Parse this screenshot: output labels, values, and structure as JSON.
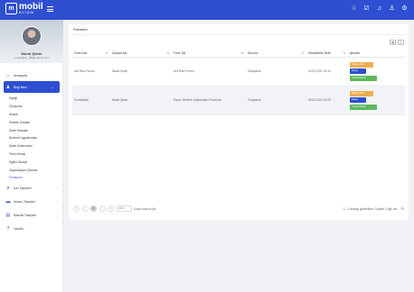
{
  "brand": {
    "logo_main": "mobil",
    "logo_sub": "BİLİŞİM"
  },
  "profile": {
    "name": "Murat Şahin",
    "email": "muratsahin_38@outlook.com"
  },
  "nav": {
    "anasayfa": "Anasayfa",
    "active_section": "Bilgi Bazı",
    "sub_items": [
      "Kişiliği",
      "Ölçüyorlar",
      "Araçlar",
      "Eksiklik Tutarları",
      "Şirket Mesaları",
      "Benimle Uygulamaları",
      "Şirket Kullanımları",
      "Temel Mesaj",
      "Eğitim Tavsiye",
      "Organizasyon Şeması",
      "Formlarım"
    ],
    "izin": "İzin Talepleri",
    "avans": "Avans Talepleri",
    "masraf": "Masraf Talepleri",
    "yardim": "Yardım"
  },
  "page": {
    "title": "Formlarım"
  },
  "table": {
    "headers": [
      "Form İsmi",
      "Çalışan Adı",
      "Form Tipi",
      "Durumu",
      "Gönderilme Tarihi",
      "İşlemler"
    ],
    "rows": [
      {
        "form_name": "Acil Rize Formu",
        "employee": "Murat Şahin",
        "form_type": "Acil Rize Formu",
        "status": "Onaylandı",
        "date": "24.03.2022 18:12"
      },
      {
        "form_name": "FormMakdi",
        "employee": "Murat Şahin",
        "form_type": "Rapor Verilerin Saklanması Protokolü",
        "status": "Onaylandı",
        "date": "05.03.2022 09:29"
      }
    ],
    "action_labels": {
      "orange": "Belgeyi Bas",
      "blue": "Detay",
      "green": "Onaylı Göster"
    }
  },
  "pager": {
    "first": "«",
    "prev": "‹",
    "current": "1",
    "next": "›",
    "last": "»",
    "page_size": "10",
    "per_page_label": "Sayfa başına öğe",
    "range_text": "1 - 2 arasıgı gösteriliyor. Toplam 2 öğe var.",
    "refresh": "⟳"
  }
}
